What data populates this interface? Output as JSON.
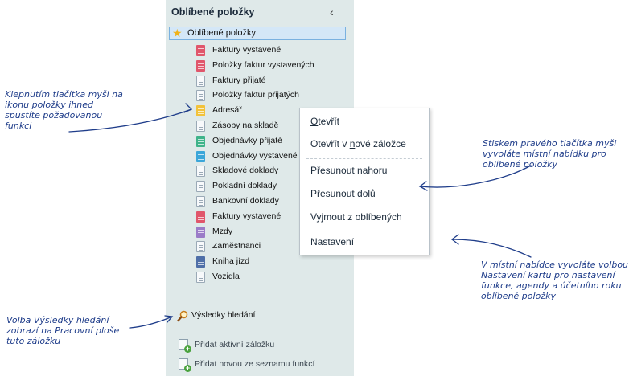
{
  "panel": {
    "title": "Oblíbené položky",
    "collapse_glyph": "‹",
    "favorites_header": "Oblíbené položky",
    "items": [
      {
        "label": "Faktury vystavené",
        "color": "#e0566b"
      },
      {
        "label": "Položky faktur vystavených",
        "color": "#e0566b"
      },
      {
        "label": "Faktury přijaté",
        "color": "white"
      },
      {
        "label": "Položky faktur přijatých",
        "color": "white"
      },
      {
        "label": "Adresář",
        "color": "#f2c23b"
      },
      {
        "label": "Zásoby na skladě",
        "color": "white"
      },
      {
        "label": "Objednávky přijaté",
        "color": "#3fb38a"
      },
      {
        "label": "Objednávky vystavené",
        "color": "#3ba6d9"
      },
      {
        "label": "Skladové doklady",
        "color": "white"
      },
      {
        "label": "Pokladní doklady",
        "color": "white"
      },
      {
        "label": "Bankovní doklady",
        "color": "white"
      },
      {
        "label": "Faktury vystavené",
        "color": "#e0566b"
      },
      {
        "label": "Mzdy",
        "color": "#9b7cc8"
      },
      {
        "label": "Zaměstnanci",
        "color": "white"
      },
      {
        "label": "Kniha jízd",
        "color": "#4f6fa8"
      },
      {
        "label": "Vozidla",
        "color": "white"
      }
    ],
    "search_results": "Výsledky hledání",
    "add_active_tab": "Přidat aktivní záložku",
    "add_from_list": "Přidat novou ze seznamu funkcí"
  },
  "context_menu": {
    "items": [
      {
        "label": "Otevřít",
        "underline": "O"
      },
      {
        "label": "Otevřít v nové záložce",
        "underline": "n"
      },
      {
        "label": "Přesunout nahoru"
      },
      {
        "label": "Přesunout dolů"
      },
      {
        "label": "Vyjmout z oblíbených"
      },
      {
        "label": "Nastavení"
      }
    ]
  },
  "annotations": {
    "click_icon": [
      "Klepnutím tlačítka myši na",
      "ikonu položky ihned",
      "spustíte požadovanou",
      "funkci"
    ],
    "right_click": [
      "Stiskem pravého tlačítka myši",
      "vyvoláte místní nabídku pro",
      "oblíbené položky"
    ],
    "settings": [
      "V místní nabídce vyvoláte volbou",
      "Nastavení kartu pro nastavení",
      "funkce, agendy a účetního roku",
      "oblíbené položky"
    ],
    "search": [
      "Volba Výsledky hledání",
      "zobrazí na Pracovní ploše",
      "tuto záložku"
    ]
  },
  "colors": {
    "panel_bg": "#dfe9e9",
    "highlight_bg": "#d4e7f7",
    "annotation": "#1f3d8a",
    "star": "#f0b21a"
  }
}
